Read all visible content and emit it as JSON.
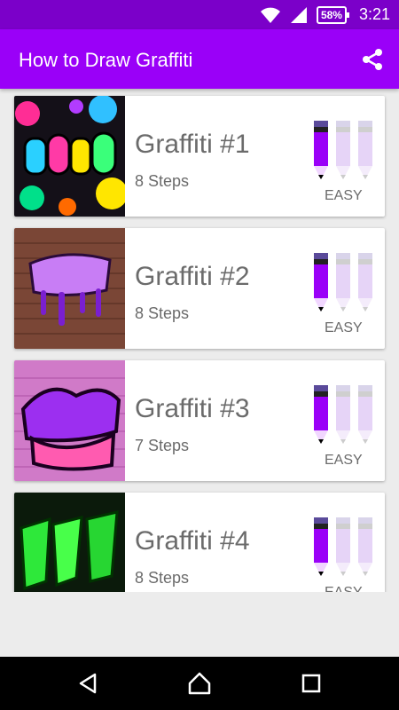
{
  "status": {
    "battery": "58%",
    "time": "3:21"
  },
  "app_bar": {
    "title": "How to Draw Graffiti",
    "share_icon": "share-icon"
  },
  "items": [
    {
      "title": "Graffiti #1",
      "steps": "8 Steps",
      "difficulty": "EASY",
      "level": 1,
      "pencils": 3
    },
    {
      "title": "Graffiti #2",
      "steps": "8 Steps",
      "difficulty": "EASY",
      "level": 1,
      "pencils": 3
    },
    {
      "title": "Graffiti #3",
      "steps": "7 Steps",
      "difficulty": "EASY",
      "level": 1,
      "pencils": 3
    },
    {
      "title": "Graffiti #4",
      "steps": "8 Steps",
      "difficulty": "EASY",
      "level": 1,
      "pencils": 3
    }
  ],
  "colors": {
    "status_bar": "#7b00c9",
    "app_bar": "#9a00f8",
    "pencil_active": "#9a00f8",
    "pencil_inactive": "#e6d4f7"
  },
  "nav": {
    "back_icon": "back-icon",
    "home_icon": "home-icon",
    "recents_icon": "recents-icon"
  }
}
